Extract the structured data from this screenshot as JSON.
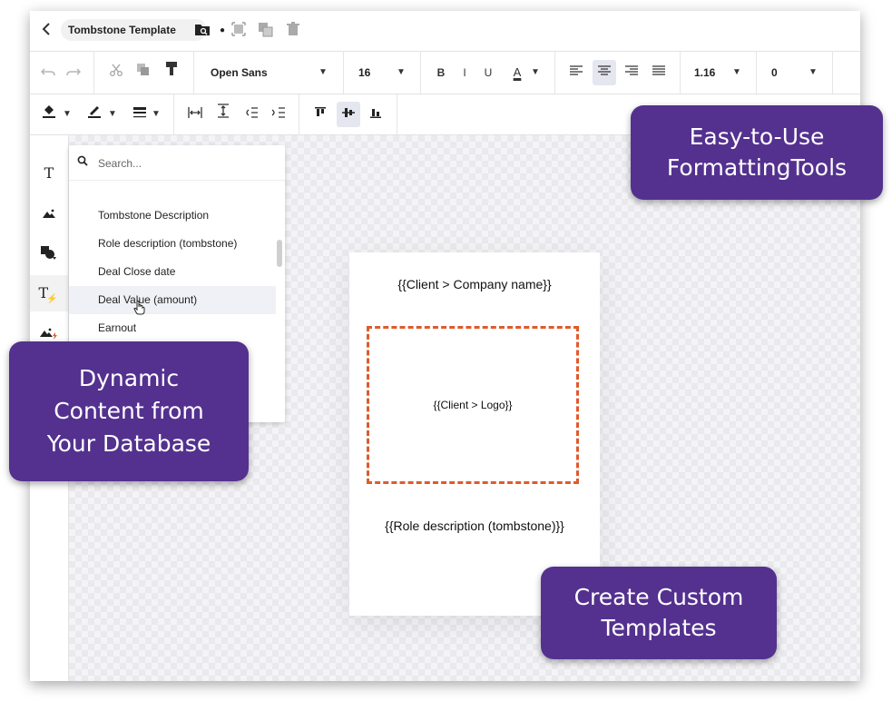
{
  "title_bar": {
    "template_name": "Tombstone Template"
  },
  "toolbar": {
    "font_family": "Open Sans",
    "font_size": "16",
    "bold_label": "B",
    "italic_label": "I",
    "underline_label": "U",
    "text_color_label": "A",
    "line_height": "1.16",
    "letter_spacing": "0"
  },
  "sidebar": {
    "text_tool_label": "T",
    "dynamic_text_label": "T"
  },
  "dropdown": {
    "search_placeholder": "Search...",
    "items": [
      "Tombstone Description",
      "Role description (tombstone)",
      "Deal Close date",
      "Deal Value (amount)",
      "Earnout"
    ],
    "hovered_index": 3
  },
  "page": {
    "company_placeholder": "{{Client > Company name}}",
    "logo_placeholder": "{{Client > Logo}}",
    "role_placeholder": "{{Role description (tombstone)}}"
  },
  "callouts": {
    "formatting": [
      "Easy-to-Use",
      "FormattingTools"
    ],
    "dynamic": [
      "Dynamic",
      "Content from",
      "Your Database"
    ],
    "custom": [
      "Create Custom",
      "Templates"
    ]
  },
  "colors": {
    "callout_bg": "#54318f",
    "logo_border": "#e05a2b",
    "accent_bolt": "#e45a2c"
  }
}
